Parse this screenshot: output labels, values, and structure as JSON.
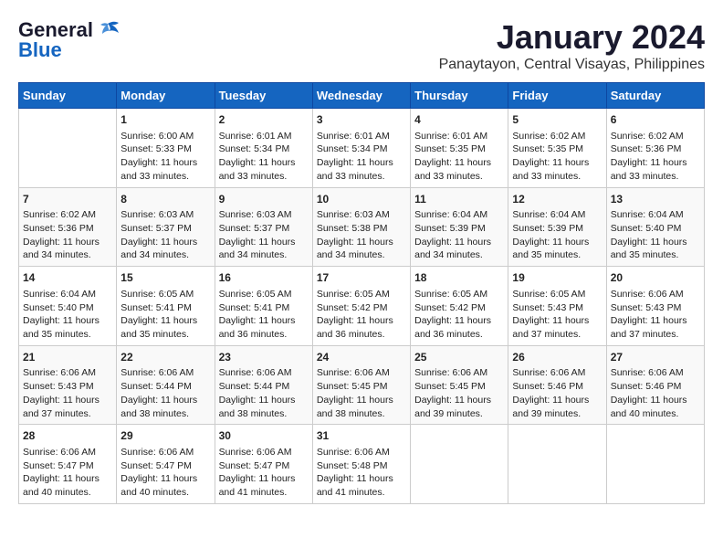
{
  "logo": {
    "line1": "General",
    "line2": "Blue"
  },
  "title": "January 2024",
  "subtitle": "Panaytayon, Central Visayas, Philippines",
  "calendar": {
    "headers": [
      "Sunday",
      "Monday",
      "Tuesday",
      "Wednesday",
      "Thursday",
      "Friday",
      "Saturday"
    ],
    "weeks": [
      [
        {
          "day": "",
          "sunrise": "",
          "sunset": "",
          "daylight": ""
        },
        {
          "day": "1",
          "sunrise": "Sunrise: 6:00 AM",
          "sunset": "Sunset: 5:33 PM",
          "daylight": "Daylight: 11 hours and 33 minutes."
        },
        {
          "day": "2",
          "sunrise": "Sunrise: 6:01 AM",
          "sunset": "Sunset: 5:34 PM",
          "daylight": "Daylight: 11 hours and 33 minutes."
        },
        {
          "day": "3",
          "sunrise": "Sunrise: 6:01 AM",
          "sunset": "Sunset: 5:34 PM",
          "daylight": "Daylight: 11 hours and 33 minutes."
        },
        {
          "day": "4",
          "sunrise": "Sunrise: 6:01 AM",
          "sunset": "Sunset: 5:35 PM",
          "daylight": "Daylight: 11 hours and 33 minutes."
        },
        {
          "day": "5",
          "sunrise": "Sunrise: 6:02 AM",
          "sunset": "Sunset: 5:35 PM",
          "daylight": "Daylight: 11 hours and 33 minutes."
        },
        {
          "day": "6",
          "sunrise": "Sunrise: 6:02 AM",
          "sunset": "Sunset: 5:36 PM",
          "daylight": "Daylight: 11 hours and 33 minutes."
        }
      ],
      [
        {
          "day": "7",
          "sunrise": "Sunrise: 6:02 AM",
          "sunset": "Sunset: 5:36 PM",
          "daylight": "Daylight: 11 hours and 34 minutes."
        },
        {
          "day": "8",
          "sunrise": "Sunrise: 6:03 AM",
          "sunset": "Sunset: 5:37 PM",
          "daylight": "Daylight: 11 hours and 34 minutes."
        },
        {
          "day": "9",
          "sunrise": "Sunrise: 6:03 AM",
          "sunset": "Sunset: 5:37 PM",
          "daylight": "Daylight: 11 hours and 34 minutes."
        },
        {
          "day": "10",
          "sunrise": "Sunrise: 6:03 AM",
          "sunset": "Sunset: 5:38 PM",
          "daylight": "Daylight: 11 hours and 34 minutes."
        },
        {
          "day": "11",
          "sunrise": "Sunrise: 6:04 AM",
          "sunset": "Sunset: 5:39 PM",
          "daylight": "Daylight: 11 hours and 34 minutes."
        },
        {
          "day": "12",
          "sunrise": "Sunrise: 6:04 AM",
          "sunset": "Sunset: 5:39 PM",
          "daylight": "Daylight: 11 hours and 35 minutes."
        },
        {
          "day": "13",
          "sunrise": "Sunrise: 6:04 AM",
          "sunset": "Sunset: 5:40 PM",
          "daylight": "Daylight: 11 hours and 35 minutes."
        }
      ],
      [
        {
          "day": "14",
          "sunrise": "Sunrise: 6:04 AM",
          "sunset": "Sunset: 5:40 PM",
          "daylight": "Daylight: 11 hours and 35 minutes."
        },
        {
          "day": "15",
          "sunrise": "Sunrise: 6:05 AM",
          "sunset": "Sunset: 5:41 PM",
          "daylight": "Daylight: 11 hours and 35 minutes."
        },
        {
          "day": "16",
          "sunrise": "Sunrise: 6:05 AM",
          "sunset": "Sunset: 5:41 PM",
          "daylight": "Daylight: 11 hours and 36 minutes."
        },
        {
          "day": "17",
          "sunrise": "Sunrise: 6:05 AM",
          "sunset": "Sunset: 5:42 PM",
          "daylight": "Daylight: 11 hours and 36 minutes."
        },
        {
          "day": "18",
          "sunrise": "Sunrise: 6:05 AM",
          "sunset": "Sunset: 5:42 PM",
          "daylight": "Daylight: 11 hours and 36 minutes."
        },
        {
          "day": "19",
          "sunrise": "Sunrise: 6:05 AM",
          "sunset": "Sunset: 5:43 PM",
          "daylight": "Daylight: 11 hours and 37 minutes."
        },
        {
          "day": "20",
          "sunrise": "Sunrise: 6:06 AM",
          "sunset": "Sunset: 5:43 PM",
          "daylight": "Daylight: 11 hours and 37 minutes."
        }
      ],
      [
        {
          "day": "21",
          "sunrise": "Sunrise: 6:06 AM",
          "sunset": "Sunset: 5:43 PM",
          "daylight": "Daylight: 11 hours and 37 minutes."
        },
        {
          "day": "22",
          "sunrise": "Sunrise: 6:06 AM",
          "sunset": "Sunset: 5:44 PM",
          "daylight": "Daylight: 11 hours and 38 minutes."
        },
        {
          "day": "23",
          "sunrise": "Sunrise: 6:06 AM",
          "sunset": "Sunset: 5:44 PM",
          "daylight": "Daylight: 11 hours and 38 minutes."
        },
        {
          "day": "24",
          "sunrise": "Sunrise: 6:06 AM",
          "sunset": "Sunset: 5:45 PM",
          "daylight": "Daylight: 11 hours and 38 minutes."
        },
        {
          "day": "25",
          "sunrise": "Sunrise: 6:06 AM",
          "sunset": "Sunset: 5:45 PM",
          "daylight": "Daylight: 11 hours and 39 minutes."
        },
        {
          "day": "26",
          "sunrise": "Sunrise: 6:06 AM",
          "sunset": "Sunset: 5:46 PM",
          "daylight": "Daylight: 11 hours and 39 minutes."
        },
        {
          "day": "27",
          "sunrise": "Sunrise: 6:06 AM",
          "sunset": "Sunset: 5:46 PM",
          "daylight": "Daylight: 11 hours and 40 minutes."
        }
      ],
      [
        {
          "day": "28",
          "sunrise": "Sunrise: 6:06 AM",
          "sunset": "Sunset: 5:47 PM",
          "daylight": "Daylight: 11 hours and 40 minutes."
        },
        {
          "day": "29",
          "sunrise": "Sunrise: 6:06 AM",
          "sunset": "Sunset: 5:47 PM",
          "daylight": "Daylight: 11 hours and 40 minutes."
        },
        {
          "day": "30",
          "sunrise": "Sunrise: 6:06 AM",
          "sunset": "Sunset: 5:47 PM",
          "daylight": "Daylight: 11 hours and 41 minutes."
        },
        {
          "day": "31",
          "sunrise": "Sunrise: 6:06 AM",
          "sunset": "Sunset: 5:48 PM",
          "daylight": "Daylight: 11 hours and 41 minutes."
        },
        {
          "day": "",
          "sunrise": "",
          "sunset": "",
          "daylight": ""
        },
        {
          "day": "",
          "sunrise": "",
          "sunset": "",
          "daylight": ""
        },
        {
          "day": "",
          "sunrise": "",
          "sunset": "",
          "daylight": ""
        }
      ]
    ]
  }
}
